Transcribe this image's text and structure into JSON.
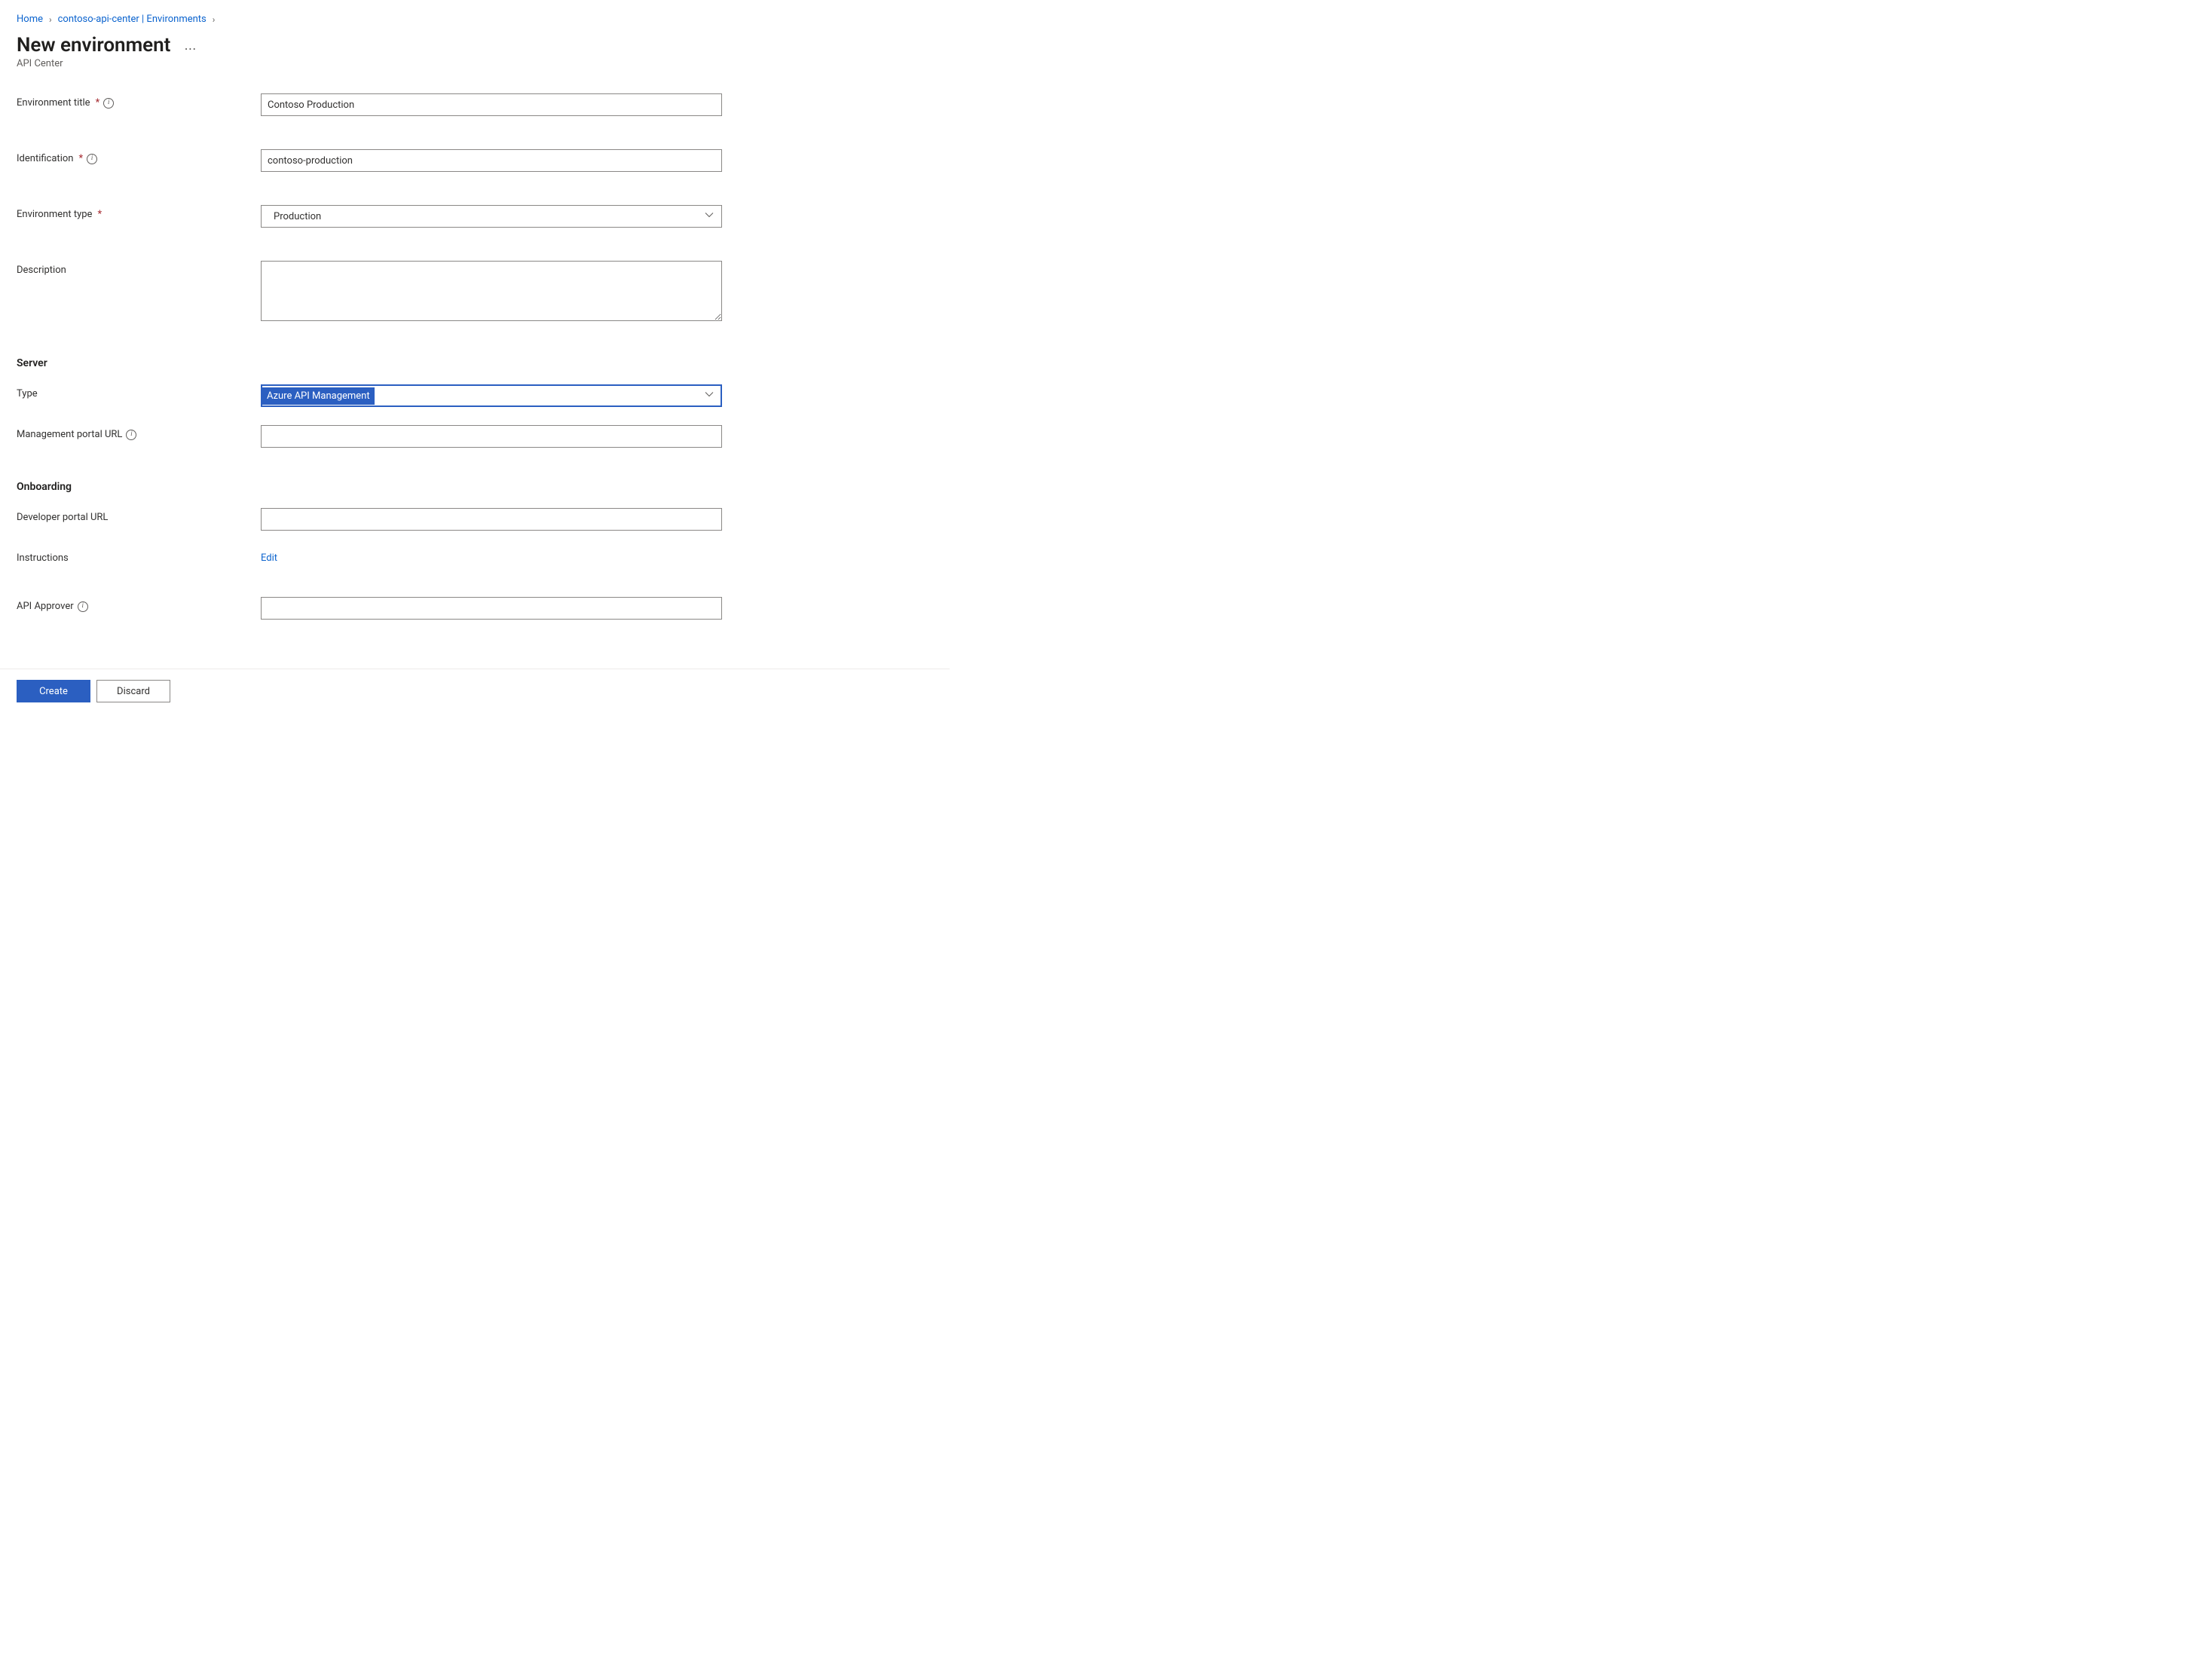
{
  "breadcrumb": {
    "home": "Home",
    "center": "contoso-api-center | Environments"
  },
  "header": {
    "title": "New environment",
    "subtitle": "API Center"
  },
  "labels": {
    "env_title": "Environment title",
    "identification": "Identification",
    "env_type": "Environment type",
    "description": "Description",
    "server_heading": "Server",
    "type": "Type",
    "mgmt_portal_url": "Management portal URL",
    "onboarding_heading": "Onboarding",
    "dev_portal_url": "Developer portal URL",
    "instructions": "Instructions",
    "api_approver": "API Approver"
  },
  "values": {
    "env_title": "Contoso Production",
    "identification": "contoso-production",
    "env_type": "Production",
    "description": "",
    "server_type": "Azure API Management",
    "mgmt_portal_url": "",
    "dev_portal_url": "",
    "api_approver": ""
  },
  "actions": {
    "edit": "Edit",
    "create": "Create",
    "discard": "Discard"
  }
}
